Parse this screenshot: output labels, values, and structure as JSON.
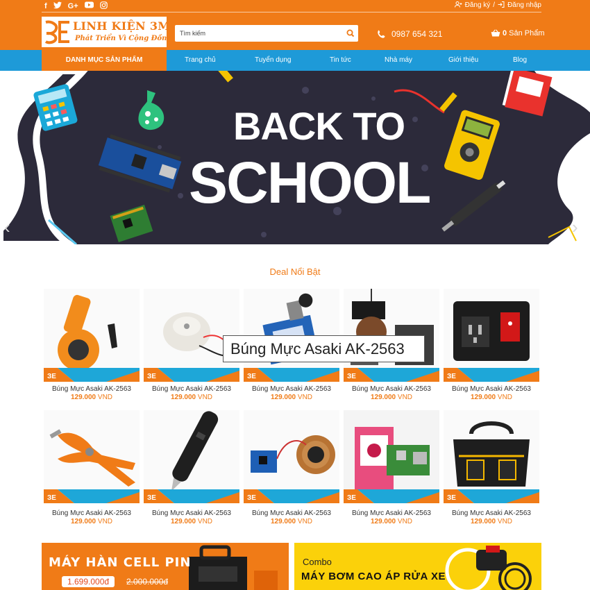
{
  "header": {
    "social": [
      "f",
      "t",
      "G+",
      "yt",
      "ig"
    ],
    "register_label": "Đăng ký",
    "separator": "/",
    "login_label": "Đăng nhập",
    "logo_title": "LINH KIỆN 3M",
    "logo_subtitle": "Phát Triển Vì Cộng Đồng",
    "search_placeholder": "Tìm kiếm",
    "hotline": "0987 654 321",
    "cart_count": "0",
    "cart_label": "Sản Phẩm"
  },
  "nav": {
    "category_label": "DANH MỤC SẢN PHẨM",
    "items": [
      "Trang chủ",
      "Tuyển dụng",
      "Tin tức",
      "Nhà máy",
      "Giới thiệu",
      "Blog"
    ]
  },
  "banner": {
    "line1": "BACK TO",
    "line2": "SCHOOL"
  },
  "deals": {
    "title": "Deal Nổi Bật",
    "tooltip": "Búng Mực Asaki AK-2563",
    "currency": "VND",
    "products": [
      {
        "name": "Búng Mực Asaki AK-2563",
        "price": "129.000"
      },
      {
        "name": "Búng Mực Asaki AK-2563",
        "price": "129.000"
      },
      {
        "name": "Búng Mực Asaki AK-2563",
        "price": "129.000"
      },
      {
        "name": "Búng Mực Asaki AK-2563",
        "price": "129.000"
      },
      {
        "name": "Búng Mực Asaki AK-2563",
        "price": "129.000"
      },
      {
        "name": "Búng Mực Asaki AK-2563",
        "price": "129.000"
      },
      {
        "name": "Búng Mực Asaki AK-2563",
        "price": "129.000"
      },
      {
        "name": "Búng Mực Asaki AK-2563",
        "price": "129.000"
      },
      {
        "name": "Búng Mực Asaki AK-2563",
        "price": "129.000"
      },
      {
        "name": "Búng Mực Asaki AK-2563",
        "price": "129.000"
      }
    ]
  },
  "promos": {
    "left_title": "MÁY HÀN CELL PIN",
    "left_new_price": "1.699.000đ",
    "left_old_price": "2.000.000đ",
    "right_combo": "Combo",
    "right_title": "MÁY BƠM CAO ÁP RỬA XE"
  },
  "colors": {
    "brand_orange": "#f07b17",
    "nav_blue": "#1e9ad8",
    "promo_yellow": "#fbd10a"
  }
}
